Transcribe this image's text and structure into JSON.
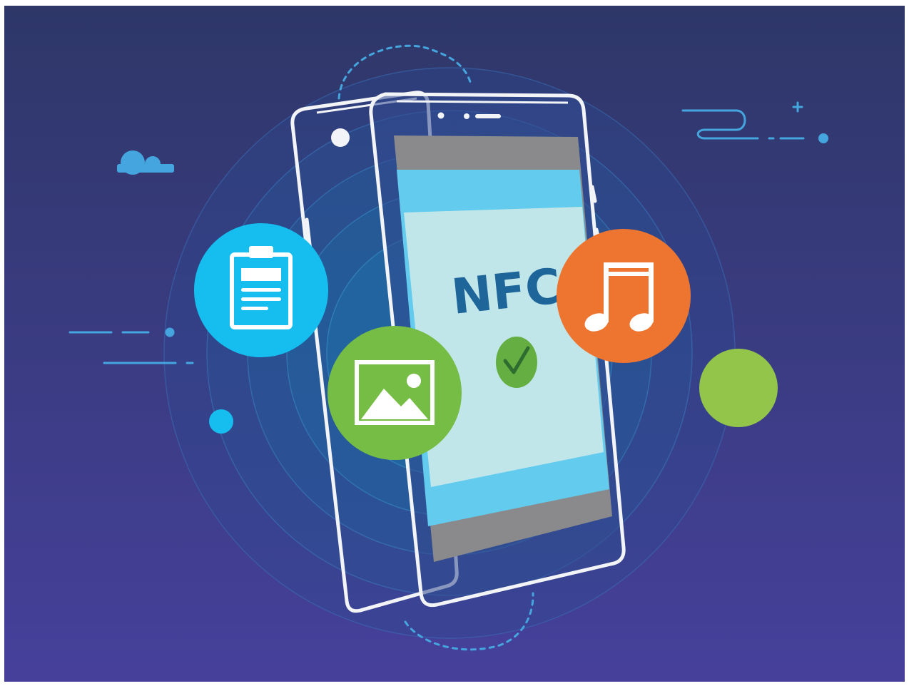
{
  "screen": {
    "label": "NFC",
    "status": "connected"
  },
  "icons": {
    "clipboard": "clipboard-icon",
    "image": "image-icon",
    "music": "music-note-icon",
    "check": "checkmark-icon",
    "cloud": "cloud-icon"
  },
  "colors": {
    "background_top": "#2E3768",
    "background_bottom": "#46409B",
    "cyan_accent": "#16BEEF",
    "image_green": "#76BD45",
    "music_orange": "#EE7530",
    "green_bubble": "#93C54B",
    "screen_band_blue": "#63CBEE",
    "screen_body": "#C1E6EA",
    "screen_gray": "#8A8A8C",
    "nfc_text_blue": "#1E6699"
  }
}
